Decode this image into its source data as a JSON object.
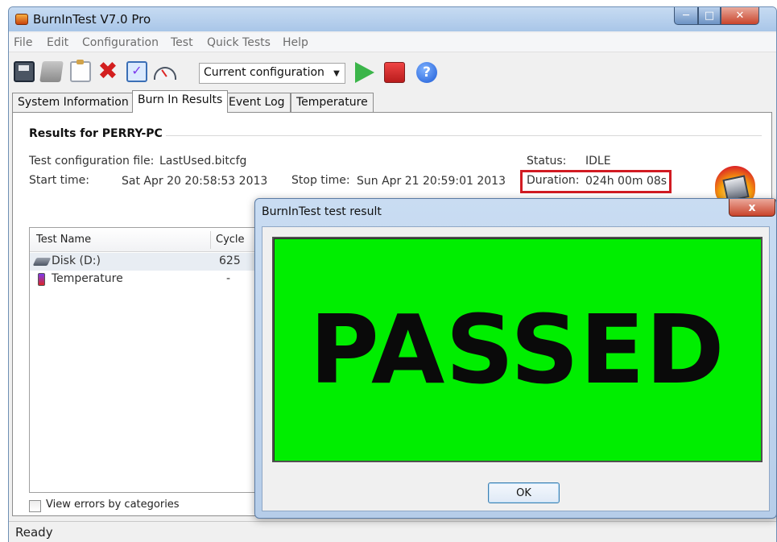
{
  "window": {
    "title": "BurnInTest V7.0 Pro"
  },
  "menu": [
    "File",
    "Edit",
    "Configuration",
    "Test",
    "Quick Tests",
    "Help"
  ],
  "toolbar": {
    "config_value": "Current configuration"
  },
  "tabs": [
    "System Information",
    "Burn In Results",
    "Event Log",
    "Temperature"
  ],
  "results": {
    "heading": "Results for PERRY-PC",
    "config_file_label": "Test configuration file:",
    "config_file_value": "LastUsed.bitcfg",
    "start_label": "Start time:",
    "start_value": "Sat Apr 20 20:58:53 2013",
    "stop_label": "Stop time:",
    "stop_value": "Sun Apr 21 20:59:01 2013",
    "status_label": "Status:",
    "status_value": "IDLE",
    "duration_label": "Duration:",
    "duration_value": "024h 00m 08s"
  },
  "table": {
    "columns": [
      "Test Name",
      "Cycle"
    ],
    "rows": [
      {
        "name": "Disk (D:)",
        "cycle": "625"
      },
      {
        "name": "Temperature",
        "cycle": "-"
      }
    ]
  },
  "view_errors_label": "View errors by categories",
  "status_bar": "Ready",
  "dialog": {
    "title": "BurnInTest test result",
    "close_label": "x",
    "result": "PASSED",
    "result_color": "#00ee00",
    "ok_label": "OK"
  },
  "colors": {
    "highlight_border": "#d11b22",
    "titlebar": "#a9c6e8"
  }
}
